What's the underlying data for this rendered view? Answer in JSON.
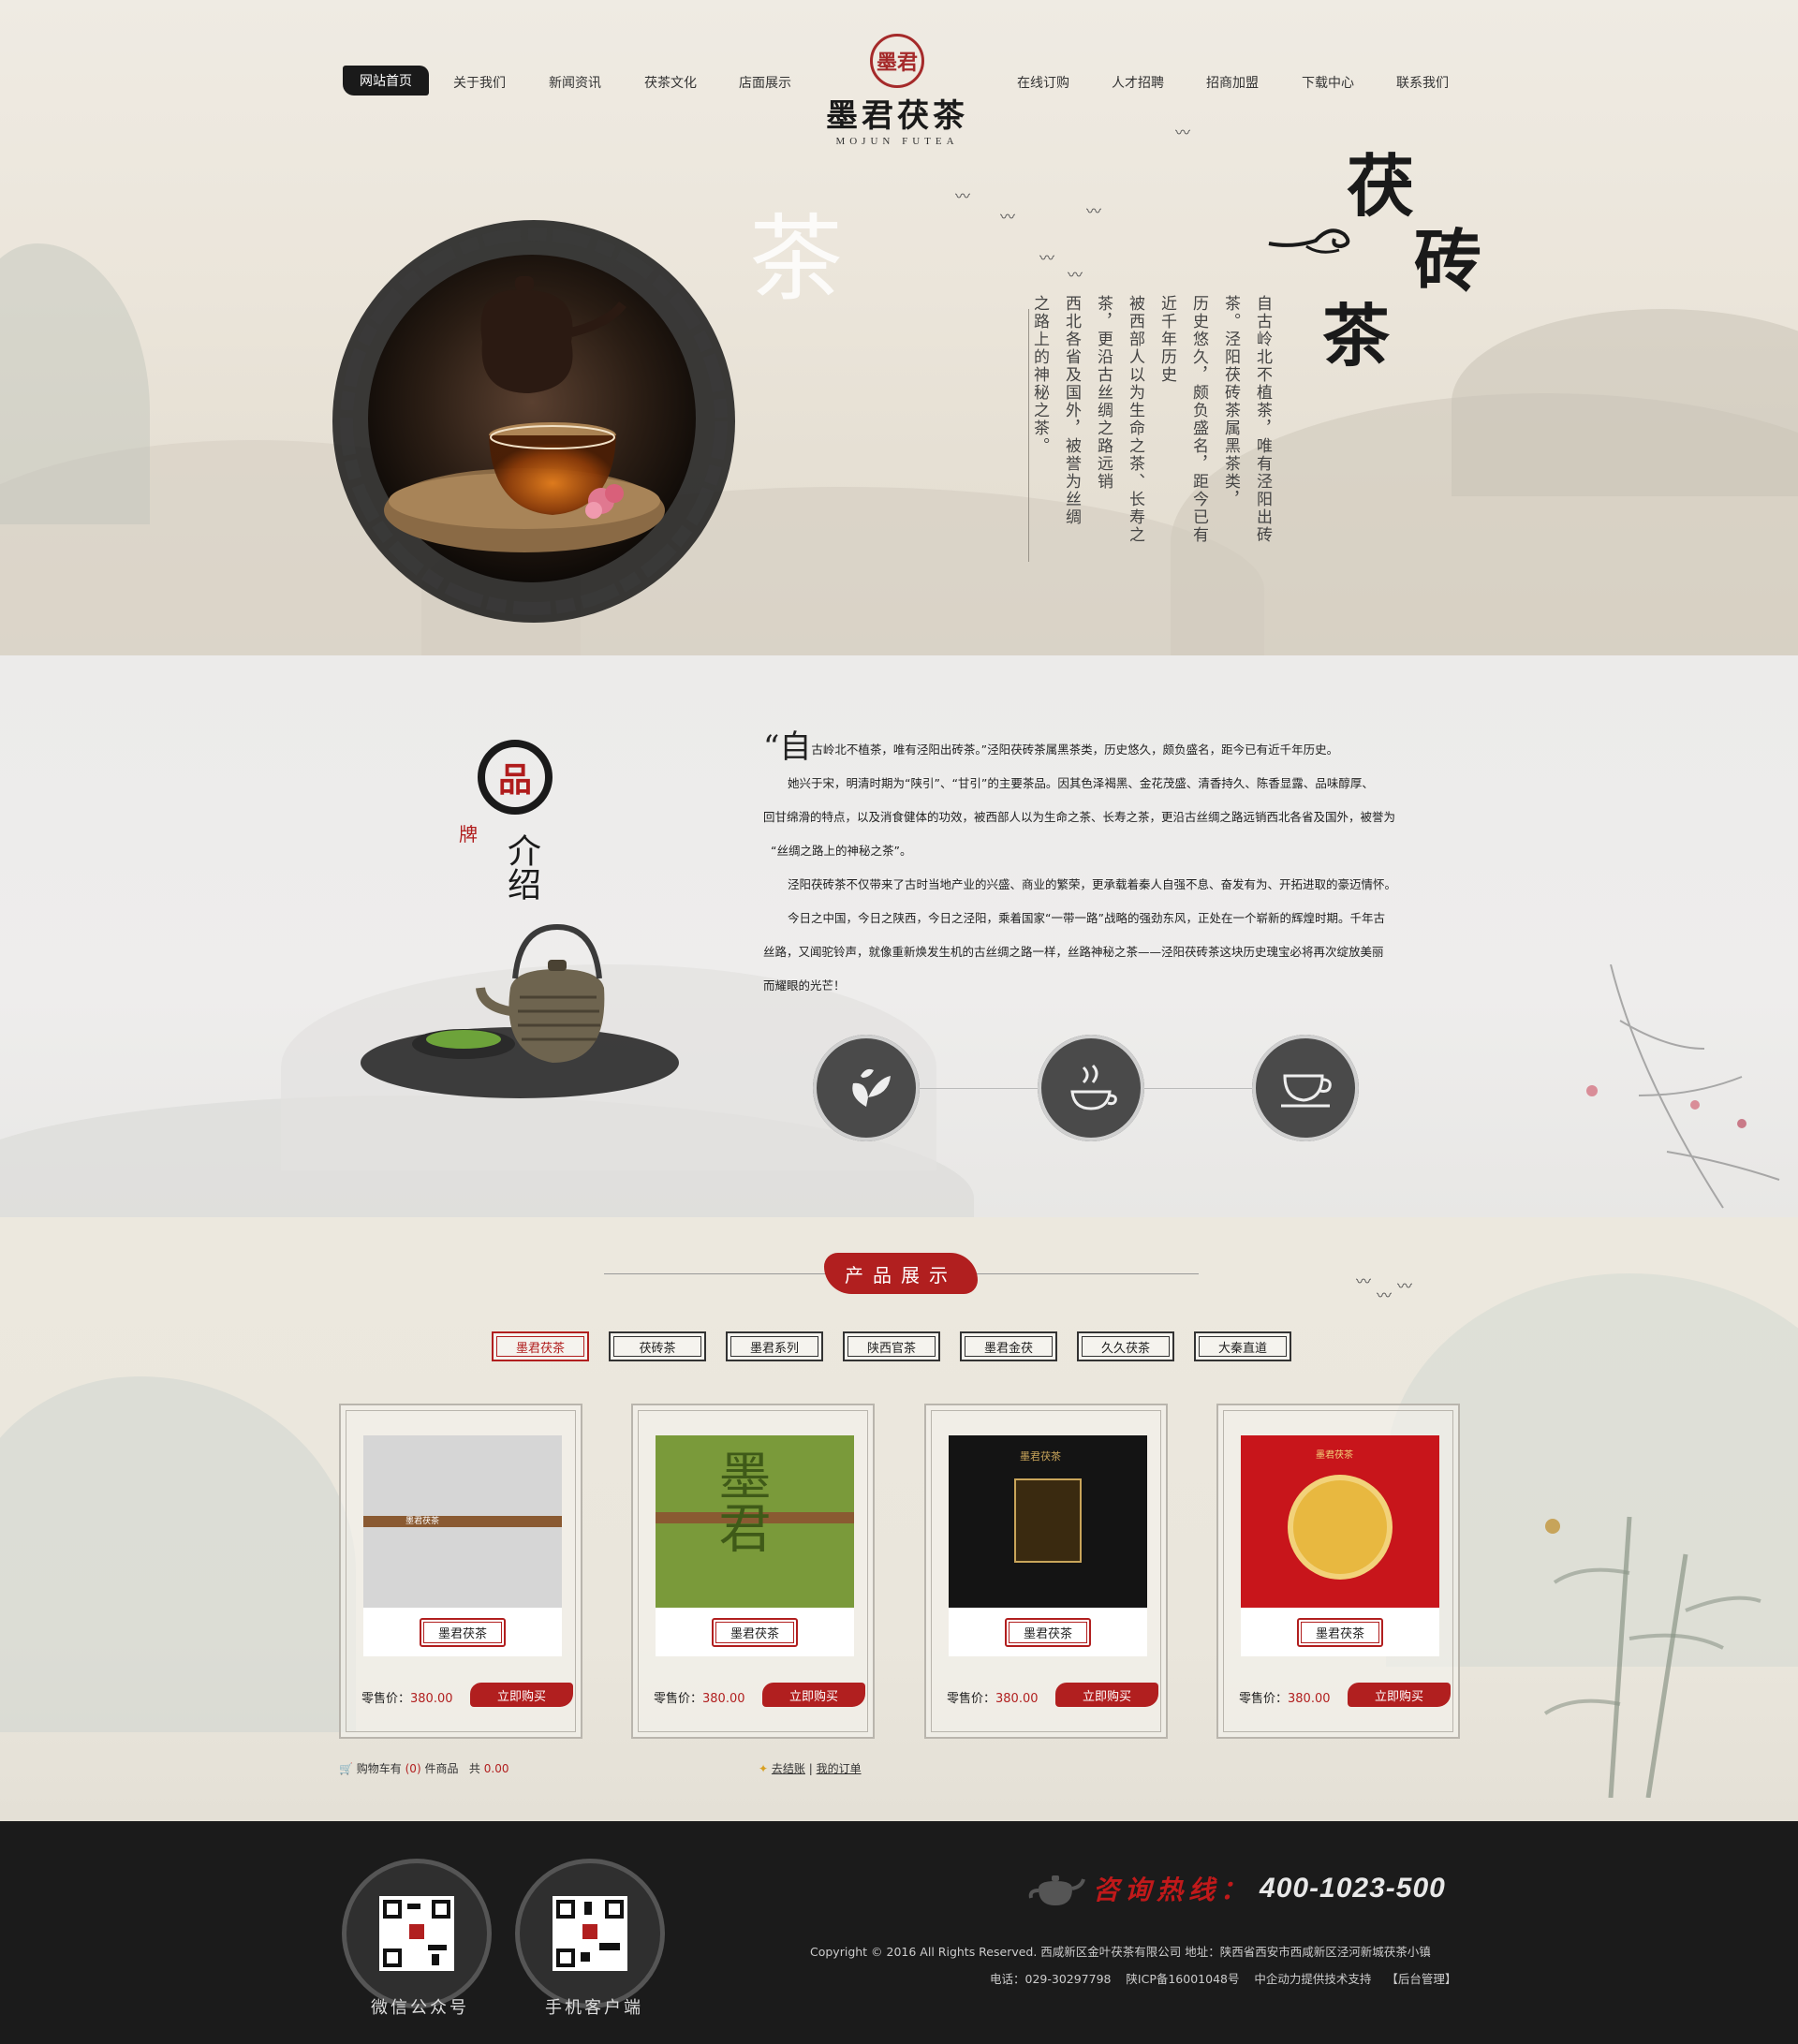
{
  "nav": {
    "left": [
      "网站首页",
      "关于我们",
      "新闻资讯",
      "茯茶文化",
      "店面展示"
    ],
    "right": [
      "在线订购",
      "人才招聘",
      "招商加盟",
      "下载中心",
      "联系我们"
    ],
    "active": "网站首页"
  },
  "logo": {
    "seal": "墨君",
    "name_cn": "墨君茯茶",
    "name_en": "MOJUN   FUTEA"
  },
  "hero": {
    "title": [
      "茯",
      "砖",
      "茶"
    ],
    "watermark": "茶",
    "poem": [
      "自古岭北不植茶，唯有泾阳出砖",
      "茶。泾阳茯砖茶属黑茶类，",
      "历史悠久，颇负盛名，距今已有",
      "近千年历史",
      "被西部人以为生命之茶、长寿之",
      "茶，更沿古丝绸之路远销",
      "西北各省及国外，被誉为丝绸",
      "之路上的神秘之茶。"
    ]
  },
  "brand": {
    "title": {
      "pin": "品",
      "pai": "牌",
      "jie": "介绍"
    },
    "para1_first": "自",
    "para1_rest": "古岭北不植茶，唯有泾阳出砖茶。”泾阳茯砖茶属黑茶类，历史悠久，颇负盛名，距今已有近千年历史。",
    "lines": [
      "她兴于宋，明清时期为“陕引”、“甘引”的主要茶品。因其色泽褐黑、金花茂盛、清香持久、陈香显露、品味醇厚、",
      "回甘绵滑的特点，以及消食健体的功效，被西部人以为生命之茶、长寿之茶，更沿古丝绸之路远销西北各省及国外，被誉为",
      "“丝绸之路上的神秘之茶”。",
      "泾阳茯砖茶不仅带来了古时当地产业的兴盛、商业的繁荣，更承载着秦人自强不息、奋发有为、开拓进取的豪迈情怀。",
      "今日之中国，今日之陕西，今日之泾阳，乘着国家“一带一路”战略的强劲东风，正处在一个崭新的辉煌时期。千年古",
      "丝路，又闻驼铃声，就像重新焕发生机的古丝绸之路一样，丝路神秘之茶——泾阳茯砖茶这块历史瑰宝必将再次绽放美丽",
      "而耀眼的光芒！"
    ],
    "icons": [
      "tea-leaf-icon",
      "steaming-cup-icon",
      "tea-cup-icon"
    ]
  },
  "products": {
    "title": "产品展示",
    "tabs": [
      "墨君茯茶",
      "茯砖茶",
      "墨君系列",
      "陕西官茶",
      "墨君金茯",
      "久久茯茶",
      "大秦直道"
    ],
    "active_tab": "墨君茯茶",
    "price_label": "零售价：",
    "buy_label": "立即购买",
    "items": [
      {
        "name": "墨君茯茶",
        "price": "380.00",
        "box_color": "#d6d6d6",
        "box_text": "墨君茯茶"
      },
      {
        "name": "墨君茯茶",
        "price": "380.00",
        "box_color": "#7a9a3a",
        "box_text": "墨君"
      },
      {
        "name": "墨君茯茶",
        "price": "380.00",
        "box_color": "#141414",
        "box_text": "墨君茯茶"
      },
      {
        "name": "墨君茯茶",
        "price": "380.00",
        "box_color": "#c8151b",
        "box_text": "墨君茯茶"
      }
    ],
    "cart": {
      "prefix": "购物车有",
      "count": "(0)",
      "unit": "件商品",
      "total_label": "共",
      "total": "0.00"
    },
    "checkout": {
      "label": "去结账",
      "orders": "我的订单"
    }
  },
  "footer": {
    "qr": [
      {
        "label": "微信公众号"
      },
      {
        "label": "手机客户端"
      }
    ],
    "hotline_label": "咨询热线：",
    "hotline": "400-1023-500",
    "copyright": "Copyright © 2016 All Rights Reserved.   西咸新区金叶茯茶有限公司     地址：陕西省西安市西咸新区泾河新城茯茶小镇",
    "phone": "电话：029-30297798",
    "icp": "陕ICP备16001048号",
    "support": "中企动力提供技术支持",
    "admin": "【后台管理】"
  },
  "colors": {
    "accent": "#b11f1f",
    "ink": "#1a1a1a",
    "footer_bg": "#1b1b1b"
  }
}
